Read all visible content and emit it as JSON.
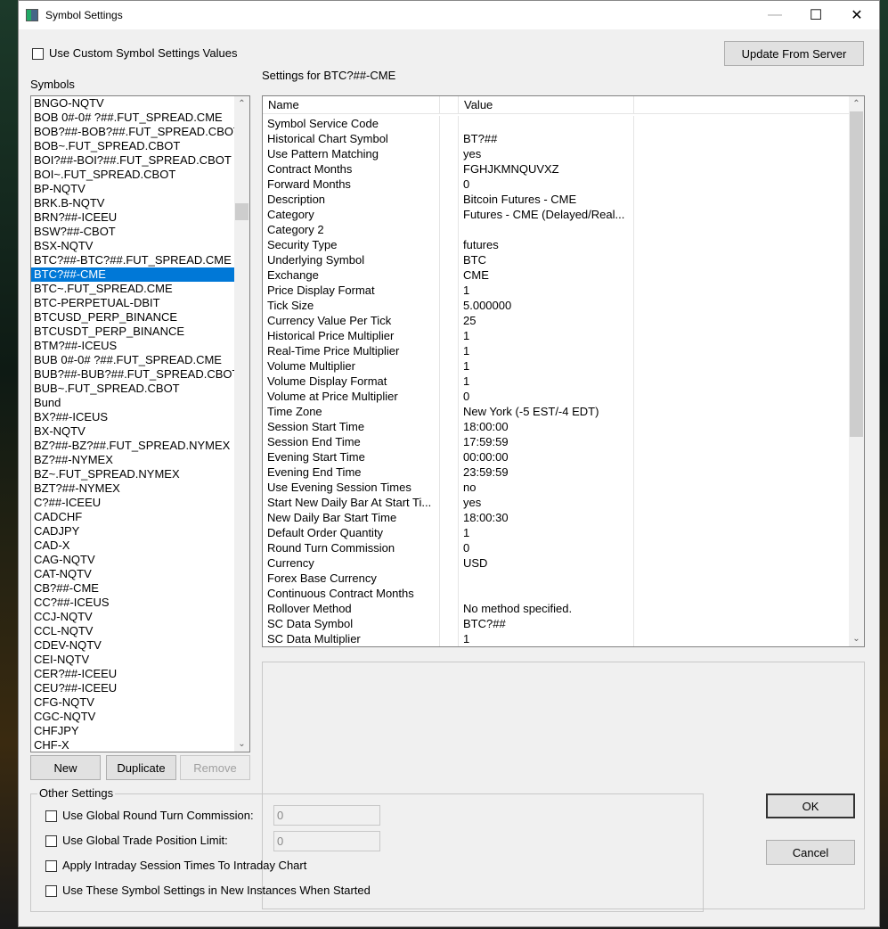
{
  "window": {
    "title": "Symbol Settings",
    "minimize": "—",
    "maximize": "☐",
    "close": "✕"
  },
  "top": {
    "custom_checkbox_label": "Use Custom Symbol Settings Values",
    "update_button": "Update From Server",
    "settings_for": "Settings for BTC?##-CME",
    "symbols_label": "Symbols"
  },
  "symbols": {
    "selected": "BTC?##-CME",
    "items": [
      "BNGO-NQTV",
      "BOB 0#-0# ?##.FUT_SPREAD.CME",
      "BOB?##-BOB?##.FUT_SPREAD.CBOT",
      "BOB~.FUT_SPREAD.CBOT",
      "BOI?##-BOI?##.FUT_SPREAD.CBOT",
      "BOI~.FUT_SPREAD.CBOT",
      "BP-NQTV",
      "BRK.B-NQTV",
      "BRN?##-ICEEU",
      "BSW?##-CBOT",
      "BSX-NQTV",
      "BTC?##-BTC?##.FUT_SPREAD.CME",
      "BTC?##-CME",
      "BTC~.FUT_SPREAD.CME",
      "BTC-PERPETUAL-DBIT",
      "BTCUSD_PERP_BINANCE",
      "BTCUSDT_PERP_BINANCE",
      "BTM?##-ICEUS",
      "BUB 0#-0# ?##.FUT_SPREAD.CME",
      "BUB?##-BUB?##.FUT_SPREAD.CBOT",
      "BUB~.FUT_SPREAD.CBOT",
      "Bund",
      "BX?##-ICEUS",
      "BX-NQTV",
      "BZ?##-BZ?##.FUT_SPREAD.NYMEX",
      "BZ?##-NYMEX",
      "BZ~.FUT_SPREAD.NYMEX",
      "BZT?##-NYMEX",
      "C?##-ICEEU",
      "CADCHF",
      "CADJPY",
      "CAD-X",
      "CAG-NQTV",
      "CAT-NQTV",
      "CB?##-CME",
      "CC?##-ICEUS",
      "CCJ-NQTV",
      "CCL-NQTV",
      "CDEV-NQTV",
      "CEI-NQTV",
      "CER?##-ICEEU",
      "CEU?##-ICEEU",
      "CFG-NQTV",
      "CGC-NQTV",
      "CHFJPY",
      "CHF-X"
    ]
  },
  "list_buttons": {
    "new": "New",
    "duplicate": "Duplicate",
    "remove": "Remove"
  },
  "grid": {
    "headers": {
      "name": "Name",
      "value": "Value"
    },
    "rows": [
      {
        "name": "Symbol Service Code",
        "value": ""
      },
      {
        "name": "Historical Chart Symbol",
        "value": "BT?##"
      },
      {
        "name": "Use Pattern Matching",
        "value": "yes"
      },
      {
        "name": "Contract Months",
        "value": "FGHJKMNQUVXZ"
      },
      {
        "name": "Forward Months",
        "value": "0"
      },
      {
        "name": "Description",
        "value": "Bitcoin Futures - CME"
      },
      {
        "name": "Category",
        "value": "Futures - CME (Delayed/Real..."
      },
      {
        "name": "Category 2",
        "value": ""
      },
      {
        "name": "Security Type",
        "value": "futures"
      },
      {
        "name": "Underlying Symbol",
        "value": "BTC"
      },
      {
        "name": "Exchange",
        "value": "CME"
      },
      {
        "name": "Price Display Format",
        "value": "1"
      },
      {
        "name": "Tick Size",
        "value": "5.000000"
      },
      {
        "name": "Currency Value Per Tick",
        "value": "25"
      },
      {
        "name": "Historical Price Multiplier",
        "value": "1"
      },
      {
        "name": "Real-Time Price Multiplier",
        "value": "1"
      },
      {
        "name": "Volume Multiplier",
        "value": "1"
      },
      {
        "name": "Volume Display Format",
        "value": "1"
      },
      {
        "name": "Volume at Price Multiplier",
        "value": "0"
      },
      {
        "name": "Time Zone",
        "value": "New York (-5 EST/-4 EDT)"
      },
      {
        "name": "Session Start Time",
        "value": "18:00:00"
      },
      {
        "name": "Session End Time",
        "value": "17:59:59"
      },
      {
        "name": "Evening Start Time",
        "value": "00:00:00"
      },
      {
        "name": "Evening End Time",
        "value": "23:59:59"
      },
      {
        "name": "Use Evening Session Times",
        "value": "no"
      },
      {
        "name": "Start New Daily Bar At Start Ti...",
        "value": "yes"
      },
      {
        "name": "New Daily Bar Start Time",
        "value": "18:00:30"
      },
      {
        "name": "Default Order Quantity",
        "value": "1"
      },
      {
        "name": "Round Turn Commission",
        "value": "0"
      },
      {
        "name": "Currency",
        "value": "USD"
      },
      {
        "name": "Forex Base Currency",
        "value": ""
      },
      {
        "name": "Continuous Contract Months",
        "value": ""
      },
      {
        "name": "Rollover Method",
        "value": "No method specified."
      },
      {
        "name": "SC Data Symbol",
        "value": "BTC?##"
      },
      {
        "name": "SC Data Multiplier",
        "value": "1"
      }
    ]
  },
  "other": {
    "legend": "Other Settings",
    "global_commission_label": "Use Global Round Turn Commission:",
    "global_commission_value": "0",
    "global_position_label": "Use Global Trade Position Limit:",
    "global_position_value": "0",
    "intraday_label": "Apply Intraday Session Times To Intraday Chart",
    "new_instances_label": "Use These Symbol Settings in New Instances When Started"
  },
  "dialog": {
    "ok": "OK",
    "cancel": "Cancel"
  }
}
